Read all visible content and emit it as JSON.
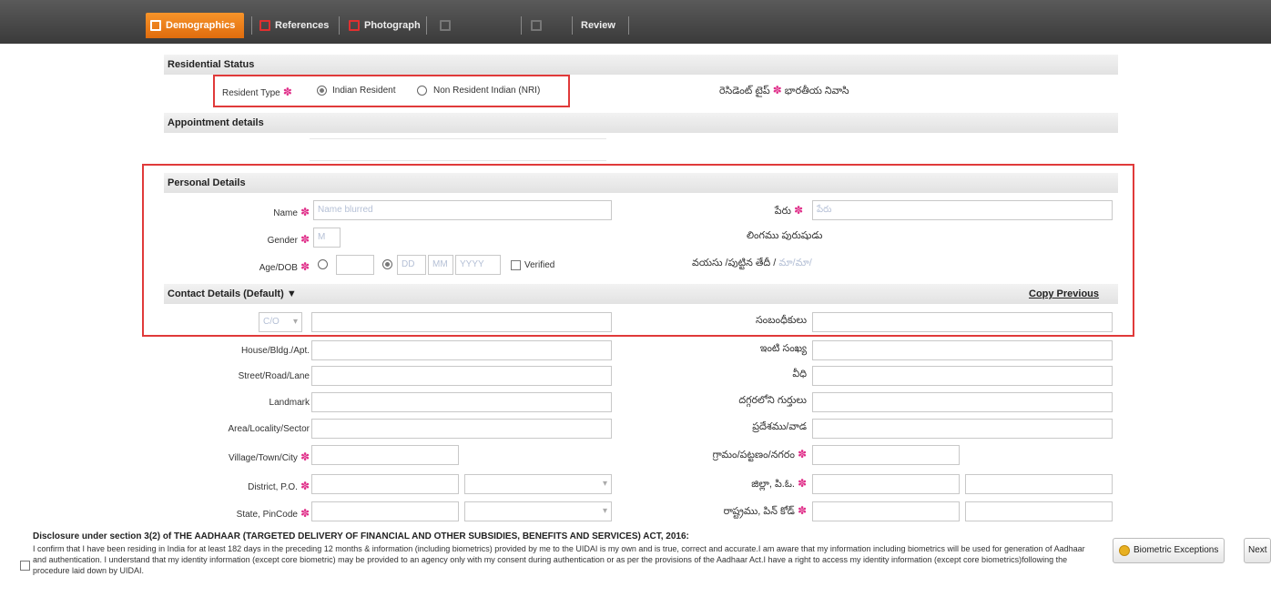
{
  "tabs": [
    {
      "label": "Demographics",
      "state": "active"
    },
    {
      "label": "References",
      "state": "normal"
    },
    {
      "label": "Photograph",
      "state": "normal"
    },
    {
      "label": "",
      "state": "disabled"
    },
    {
      "label": "",
      "state": "disabled"
    },
    {
      "label": "Review",
      "state": "normal"
    }
  ],
  "residential": {
    "header": "Residential Status",
    "resident_type_label": "Resident Type",
    "option_indian": "Indian Resident",
    "option_nri": "Non Resident Indian (NRI)",
    "local_label": "రెసిడెంట్ టైప్",
    "local_value": "భారతీయ నివాసి"
  },
  "appointment": {
    "header": "Appointment details"
  },
  "personal": {
    "header": "Personal Details",
    "name_label": "Name",
    "name_value": "Name blurred",
    "name_local_label": "పేరు",
    "name_local_value": "పేరు",
    "gender_label": "Gender",
    "gender_value": "M",
    "gender_local_label": "లింగము",
    "gender_local_value": "పురుషుడు",
    "age_label": "Age/DOB",
    "dob_day": "DD",
    "dob_month": "MM",
    "dob_year": "YYYY",
    "verified_label": "Verified",
    "age_local_label": "వయసు /పుట్టిన తేదీ /",
    "age_local_value": "మా/మా/"
  },
  "contact": {
    "header": "Contact Details (Default)",
    "header_arrow": "▼",
    "copy_previous": "Copy Previous",
    "care_of_select": "C/O",
    "care_of_local_label": "సంబంధీకులు",
    "fields_left": [
      {
        "label": "House/Bldg./Apt."
      },
      {
        "label": "Street/Road/Lane"
      },
      {
        "label": "Landmark"
      },
      {
        "label": "Area/Locality/Sector"
      },
      {
        "label": "Village/Town/City"
      },
      {
        "label": "District, P.O."
      },
      {
        "label": "State, PinCode"
      }
    ],
    "fields_right": [
      {
        "label": "ఇంటి సంఖ్య"
      },
      {
        "label": "వీధి"
      },
      {
        "label": "దగ్గరలోని గుర్తులు"
      },
      {
        "label": "ప్రదేశము/వాడ"
      },
      {
        "label": "గ్రామం/పట్టణం/నగరం"
      },
      {
        "label": "జిల్లా, పి.ఓ."
      },
      {
        "label": "రాష్ట్రము, పిన్ కోడ్"
      }
    ]
  },
  "disclosure": {
    "title": "Disclosure under section 3(2) of THE AADHAAR (TARGETED DELIVERY OF FINANCIAL AND OTHER SUBSIDIES, BENEFITS AND SERVICES) ACT, 2016:",
    "text": "I confirm that I have been residing in India for at least 182 days in the preceding 12 months & information (including biometrics) provided by me to the UIDAI is my own and is true, correct and accurate.I am aware that my information including biometrics will be used for generation of Aadhaar and authentication. I understand that my identity information (except core biometric) may be provided to an agency only with my consent during authentication or as per the provisions of the Aadhaar Act.I have a right to access my identity information (except core biometrics)following the procedure laid down by UIDAI."
  },
  "buttons": {
    "biometric_exceptions": "Biometric Exceptions",
    "next": "Next"
  },
  "colors": {
    "highlight_border": "#e03a3a",
    "active_tab": "#f7942a",
    "required_star": "#e0308a"
  }
}
